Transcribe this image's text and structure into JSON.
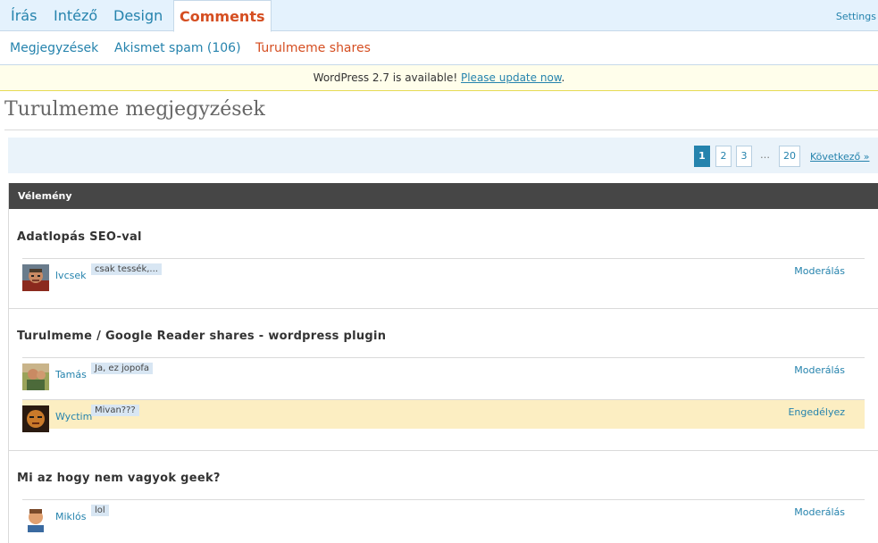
{
  "tabs": [
    "Írás",
    "Intéző",
    "Design",
    "Comments"
  ],
  "settings_label": "Settings",
  "subnav": [
    "Megjegyzések",
    "Akismet spam (106)",
    "Turulmeme shares"
  ],
  "notice": {
    "text": "WordPress 2.7 is available! ",
    "link": "Please update now",
    "end": "."
  },
  "page_title": "Turulmeme megjegyzések",
  "pagination": {
    "pages": [
      "1",
      "2",
      "3",
      "…",
      "20"
    ],
    "next": "Következő »"
  },
  "table_header": "Vélemény",
  "groups": [
    {
      "title": "Adatlopás SEO-val",
      "comments": [
        {
          "author": "lvcsek",
          "excerpt": "csak tessék,...",
          "action": "Moderálás"
        }
      ]
    },
    {
      "title": "Turulmeme / Google Reader shares - wordpress plugin",
      "comments": [
        {
          "author": "Tamás",
          "excerpt": "Ja, ez jopofa",
          "action": "Moderálás"
        },
        {
          "author": "Wyctim",
          "excerpt": "Mivan???",
          "action": "Engedélyez"
        }
      ]
    },
    {
      "title": "Mi az hogy nem vagyok geek?",
      "comments": [
        {
          "author": "Miklós",
          "excerpt": "lol",
          "action": "Moderálás"
        }
      ]
    }
  ],
  "colors": {
    "link": "#2583ad",
    "active": "#d54e21",
    "header_bg": "#464646",
    "highlight": "#fceec2"
  }
}
